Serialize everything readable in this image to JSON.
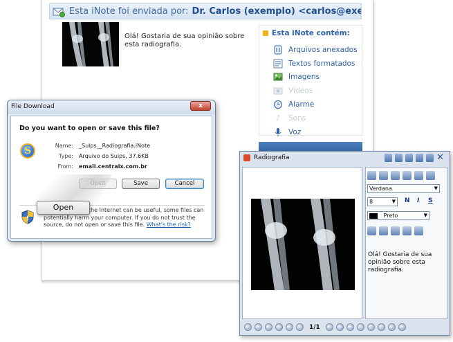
{
  "email": {
    "header_prefix": "Esta iNote foi enviada por:",
    "header_sender": "Dr. Carlos (exemplo) <carlos@exemplo.com>",
    "message": "Olá! Gostaria de sua opinião sobre esta radiografia.",
    "contains_title": "Esta iNote contém:",
    "contains_items": [
      {
        "label": "Arquivos anexados",
        "icon": "paperclip-icon",
        "enabled": true
      },
      {
        "label": "Textos formatados",
        "icon": "formatted-text-icon",
        "enabled": true
      },
      {
        "label": "Imagens",
        "icon": "image-icon",
        "enabled": true
      },
      {
        "label": "Vídeos",
        "icon": "video-icon",
        "enabled": false
      },
      {
        "label": "Alarme",
        "icon": "alarm-icon",
        "enabled": true
      },
      {
        "label": "Sons",
        "icon": "music-note-icon",
        "enabled": false
      },
      {
        "label": "Voz",
        "icon": "microphone-icon",
        "enabled": true
      }
    ]
  },
  "download_dialog": {
    "title": "File Download",
    "question": "Do you want to open or save this file?",
    "fields": [
      {
        "label": "Name:",
        "value": "_Suips__Radiografia.iNote",
        "bold": false
      },
      {
        "label": "Type:",
        "value": "Arquivo do Suips, 37.6KB",
        "bold": false
      },
      {
        "label": "From:",
        "value": "email.centralx.com.br",
        "bold": true
      }
    ],
    "buttons": {
      "open": "Open",
      "save": "Save",
      "cancel": "Cancel"
    },
    "warning_part1": "While files from the Internet can be useful, some files can potentially harm your computer. If you do not trust the source, do not open or save this file.",
    "warning_link": "What's the risk?",
    "close_label": "x"
  },
  "open_callout": "Open",
  "viewer": {
    "title": "Radiografia",
    "font": "Verdana",
    "size": "8",
    "color": "Preto",
    "format_buttons": [
      "N",
      "I",
      "S"
    ],
    "text": "Olá! Gostaria de sua opinião sobre esta radiografia.",
    "page": "1/1"
  }
}
